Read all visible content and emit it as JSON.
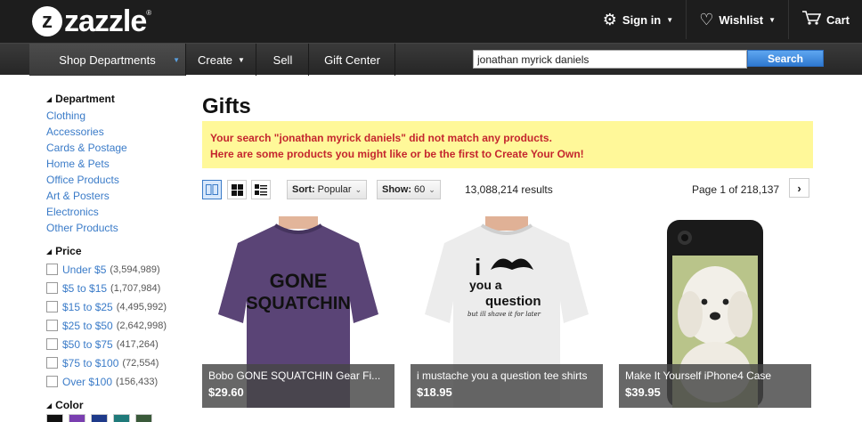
{
  "header": {
    "logo_text": "zazzle",
    "logo_badge": "z",
    "logo_reg": "®",
    "sign_in": "Sign in",
    "wishlist": "Wishlist",
    "cart": "Cart"
  },
  "nav": {
    "shop_departments": "Shop Departments",
    "create": "Create",
    "sell": "Sell",
    "gift_center": "Gift Center"
  },
  "search": {
    "value": "jonathan myrick daniels",
    "button": "Search"
  },
  "sidebar": {
    "department_heading": "Department",
    "departments": [
      "Clothing",
      "Accessories",
      "Cards & Postage",
      "Home & Pets",
      "Office Products",
      "Art & Posters",
      "Electronics",
      "Other Products"
    ],
    "price_heading": "Price",
    "prices": [
      {
        "label": "Under $5",
        "count": "(3,594,989)"
      },
      {
        "label": "$5 to $15",
        "count": "(1,707,984)"
      },
      {
        "label": "$15 to $25",
        "count": "(4,495,992)"
      },
      {
        "label": "$25 to $50",
        "count": "(2,642,998)"
      },
      {
        "label": "$50 to $75",
        "count": "(417,264)"
      },
      {
        "label": "$75 to $100",
        "count": "(72,554)"
      },
      {
        "label": "Over $100",
        "count": "(156,433)"
      }
    ],
    "color_heading": "Color",
    "colors": [
      "#111111",
      "#7a3fb0",
      "#1e3a8a",
      "#1f7a7a",
      "#3a5a3a"
    ]
  },
  "main": {
    "title": "Gifts",
    "notice_line1": "Your search \"jonathan myrick daniels\" did not match any products.",
    "notice_line2": "Here are some products you might like or be the first to Create Your Own!",
    "sort_label": "Sort:",
    "sort_value": "Popular",
    "show_label": "Show:",
    "show_value": "60",
    "results": "13,088,214 results",
    "page_indicator": "Page 1 of 218,137",
    "next": "›"
  },
  "products": [
    {
      "title": "Bobo GONE SQUATCHIN Gear Fi...",
      "price": "$29.60",
      "shirt_text_1": "GONE",
      "shirt_text_2": "SQUATCHIN"
    },
    {
      "title": "i mustache you a question tee shirts",
      "price": "$18.95",
      "shirt_text_1": "i",
      "shirt_text_2": "you a",
      "shirt_text_3": "question",
      "shirt_text_4": "but ill shave it for later"
    },
    {
      "title": "Make It Yourself iPhone4 Case",
      "price": "$39.95"
    }
  ]
}
